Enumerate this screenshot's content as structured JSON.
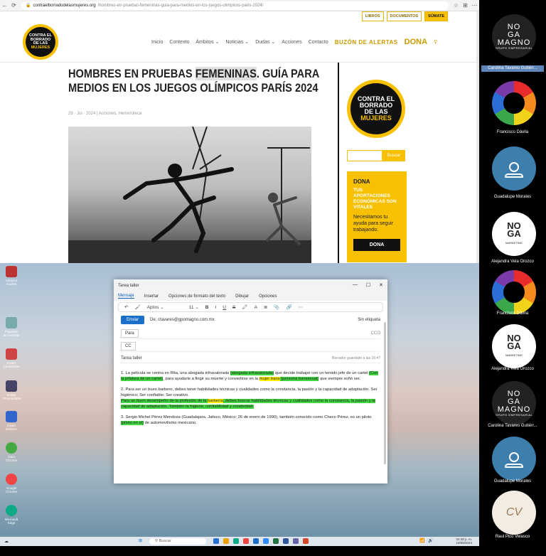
{
  "browser": {
    "url_host": "contraelborradodelasmujeres.org",
    "url_path": "/hombres-en-pruebas-femeninas-guia-para-medios-en-los-juegos-olimpicos-paris-2024/"
  },
  "site": {
    "top_buttons": [
      "LIBROS",
      "DOCUMENTOS",
      "SÚMATE"
    ],
    "logo_lines": [
      "CONTRA EL",
      "BORRADO",
      "DE LAS",
      "MUJERES"
    ],
    "nav": [
      "Inicio",
      "Contexto",
      "Ámbitos",
      "Noticias",
      "Dudas",
      "Acciones",
      "Contacto"
    ],
    "nav_alert": "BUZÓN DE ALERTAS",
    "nav_dona": "DONA",
    "title_pre": "HOMBRES EN PRUEBAS ",
    "title_hl": "FEMENINAS",
    "title_post": ". GUÍA PARA MEDIOS EN LOS JUEGOS OLÍMPICOS PARÍS 2024",
    "meta": "28 · Jul · 2024 | Acciones, Hemeroteca",
    "search_btn": "Buscar",
    "dona_title": "DONA",
    "dona_sub": "TUS APORTACIONES ECONÓMICAS SON VITALES",
    "dona_text": "Necesitamos tu ayuda para seguir trabajando.",
    "dona_btn": "DONA"
  },
  "desktop": {
    "icons": [
      {
        "label": "Autorizó Auxiliar",
        "color": "#b33"
      },
      {
        "label": "Papelera de reciclaje",
        "color": "#7aa"
      },
      {
        "label": "Invitar Cantidades",
        "color": "#c44"
      },
      {
        "label": "Invitar Proveedores",
        "color": "#446"
      },
      {
        "label": "Invitar Dolares",
        "color": "#36c"
      },
      {
        "label": "Gaia Chrome",
        "color": "#4a4"
      },
      {
        "label": "Google Chrome",
        "color": "#e44"
      },
      {
        "label": "Microsoft Edge",
        "color": "#1a8"
      }
    ],
    "taskbar_search": "Buscar",
    "clock_time": "04:48 p. m.",
    "clock_date": "19/08/2024"
  },
  "mail": {
    "window_title": "Tarea taller",
    "tabs": [
      "Mensaje",
      "Insertar",
      "Opciones de formato del texto",
      "Dibujar",
      "Opciones"
    ],
    "font": "Aptos",
    "size": "11",
    "send": "Enviar",
    "from": "De: ctavares@gpomagno.com.mx",
    "label": "Sin etiqueta",
    "to_label": "Para",
    "cco": "CCO",
    "cc_label": "CC",
    "subject": "Tarea taller",
    "saved": "Borrador guardado a las 16:47",
    "p1": {
      "a": "1. La película se centra en Rita, una abogada infravalorada ",
      "h1": "(abogada infravalorada)",
      "b": " que decide trabajar con un temido jefe de un cartel ",
      "h2": "(Con la jefatura de un cartel)",
      "c": ", para ayudarle a fingir su muerte y convertirse en la ",
      "h3": "mujer trans",
      "h4": " (persona transexual)",
      "d": " que siempre soñó ser."
    },
    "p2": {
      "a": "2. Para ser un buen barbero, debes tener habilidades técnicas y cualidades como la constancia, la pasión y la capacidad de adaptación. Ser higiénico; Ser confiable; Ser creativo.",
      "h1": "Para un buen desempeño de  la profesión de la ",
      "h2": "barbería",
      "h3": ", debes buscar habilidades técnicas y cualidades como la constancia, la pasión y la capacidad de adaptación. También la higiene, confiabilidad y creatividad."
    },
    "p3": {
      "a": "3. Sergio Michel Pérez Mendoza (Guadalajara, Jalisco, México; 26 de enero de 1990), también conocido como Checo Pérez, es un piloto ",
      "h1": "(piloto en el)",
      "b": " de automovilismo mexicano."
    }
  },
  "participants": [
    {
      "name": "Carolina Tavares Gutiérr...",
      "avatar": "magno",
      "host": true
    },
    {
      "name": "Francisco Dávila",
      "avatar": "rainbow"
    },
    {
      "name": "Guadalupe Morales",
      "avatar": "person"
    },
    {
      "name": "Alejandra Vela Orozco",
      "avatar": "noga"
    },
    {
      "name": "Francisco Dávila",
      "avatar": "rainbow"
    },
    {
      "name": "Alejandra Vela Orozco",
      "avatar": "noga"
    },
    {
      "name": "Carolina Tavares Gutiérr...",
      "avatar": "magno"
    },
    {
      "name": "Guadalupe Morales",
      "avatar": "person"
    },
    {
      "name": "Raul Pico Velasco",
      "avatar": "raul"
    }
  ],
  "avatar_text": {
    "magno_1": "NO",
    "magno_2": "GA",
    "magno_3": "MAGNO",
    "magno_4": "GRUPO EMPRESARIAL",
    "noga_1": "NO",
    "noga_2": "GA",
    "noga_3": "MARKETING",
    "raul": "CV"
  }
}
